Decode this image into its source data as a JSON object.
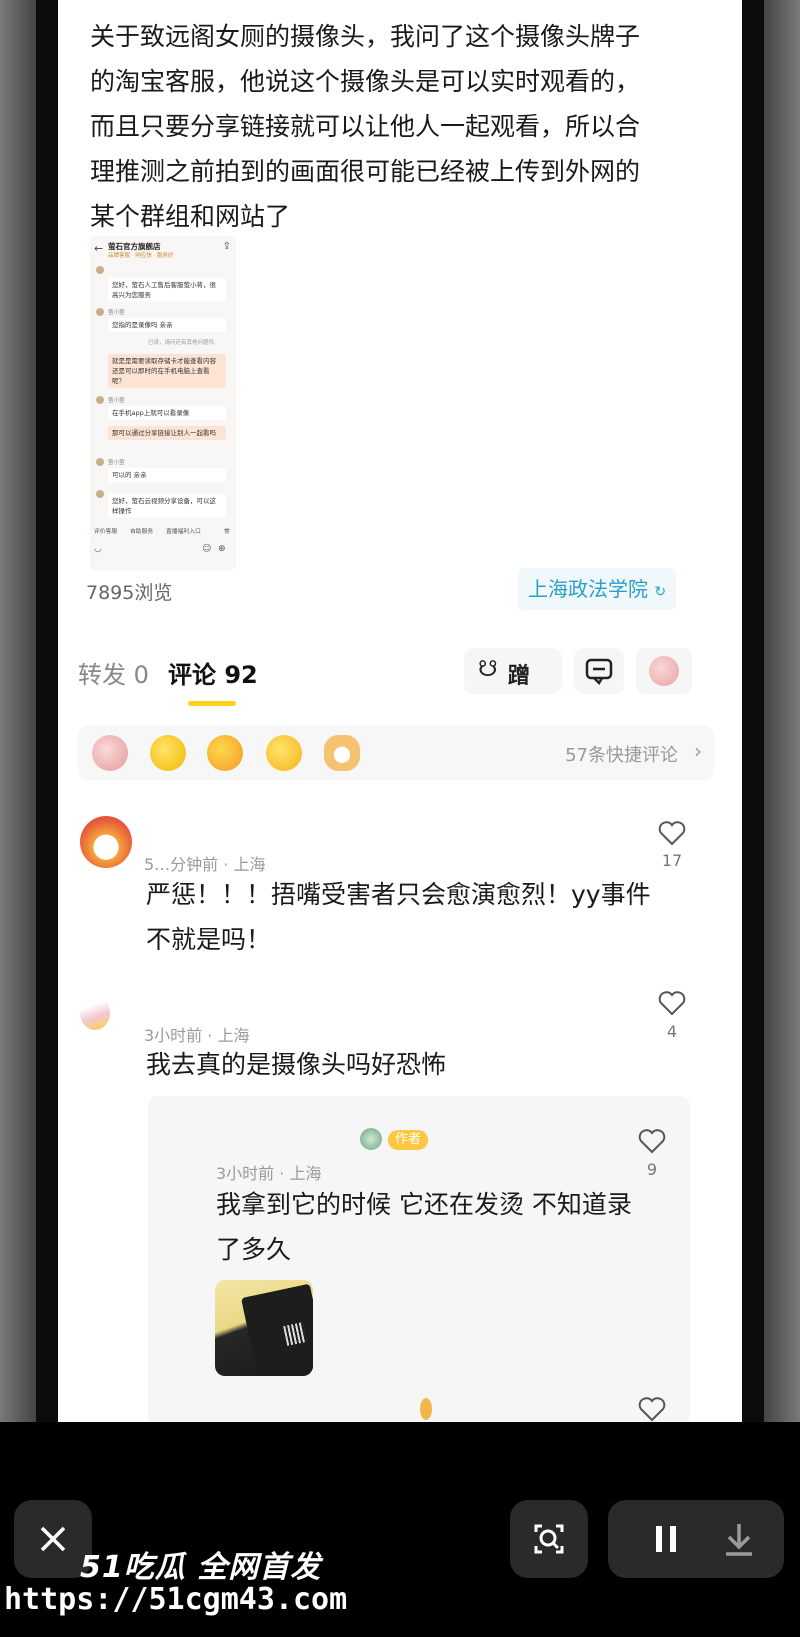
{
  "post": {
    "text_lines": [
      "关于致远阁女厕的摄像头，我问了这个摄像头牌子",
      "的淘宝客服，他说这个摄像头是可以实时观看的，",
      "而且只要分享链接就可以让他人一起观看，所以合",
      "理推测之前拍到的画面很可能已经被上传到外网的",
      "某个群组和网站了"
    ],
    "views": "7895浏览",
    "location_tag": "上海政法学院"
  },
  "screenshot": {
    "shop_title": "萤石官方旗舰店",
    "shop_subtitle": "品牌客服 · 响应快 · 服务好",
    "agent_name": "萤小萤",
    "msg1": "您好，萤石人工售后客服萤小蒋，很高兴为您服务",
    "msg2": "您指的是录像吗 亲亲",
    "note": "已读，请问还有其他问题吗",
    "q1": "就是是需要读取存储卡才能查看内容还是可以即时的在手机电脑上查看呢？",
    "msg3": "在手机app上就可以看录像",
    "q2": "那可以通过分享链接让别人一起看吗",
    "msg4": "可以的 亲亲",
    "msg5": "您好，萤石云视频分享设备，可以这样操作",
    "bar_items": [
      "评价客服",
      "自助服务",
      "直播福利入口",
      "常"
    ]
  },
  "tabs": {
    "forward": "转发 0",
    "comment": "评论 92"
  },
  "actions": {
    "ceng_label": "蹭"
  },
  "quick_comments": {
    "label": "57条快捷评论"
  },
  "comments": [
    {
      "meta": "5…分钟前 · 上海",
      "likes": "17",
      "text_lines": [
        "严惩！！！捂嘴受害者只会愈演愈烈！yy事件",
        "不就是吗！"
      ]
    },
    {
      "meta": "3小时前 · 上海",
      "likes": "4",
      "text_lines": [
        "我去真的是摄像头吗好恐怖"
      ]
    }
  ],
  "reply": {
    "badge": "作者",
    "meta": "3小时前 · 上海",
    "likes": "9",
    "text_lines": [
      "我拿到它的时候 它还在发烫 不知道录",
      "了多久"
    ]
  },
  "watermark": {
    "line1": "51吃瓜 全网首发",
    "line2": "https://51cgm43.com"
  },
  "colors": {
    "accent_yellow": "#ffd21e",
    "location_blue": "#2aa0c8",
    "author_badge": "#ffc640"
  }
}
